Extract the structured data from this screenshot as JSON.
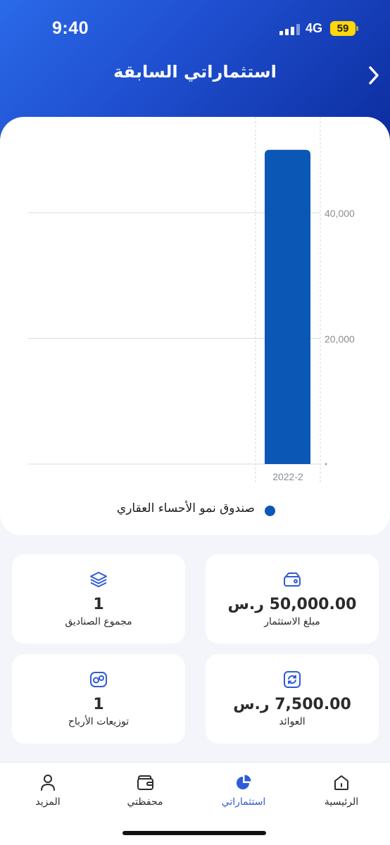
{
  "status_bar": {
    "time": "9:40",
    "network": "4G",
    "battery": "59"
  },
  "header": {
    "title": "استثماراتي السابقة",
    "back_icon": "chevron-right-icon"
  },
  "chart_data": {
    "type": "bar",
    "categories": [
      "2022-2"
    ],
    "series": [
      {
        "name": "صندوق نمو الأحساء العقاري",
        "values": [
          50000
        ]
      }
    ],
    "y_ticks": [
      "40,000",
      "20,000"
    ],
    "y_tick_values": [
      40000,
      20000
    ],
    "ylim": [
      0,
      50000
    ],
    "grid": true,
    "legend": "bottom",
    "bar_color": "#0b57b5"
  },
  "legend": {
    "label": "صندوق نمو الأحساء العقاري"
  },
  "stats": {
    "investment_amount": {
      "value": "50,000.00 ر.س",
      "label": "مبلغ الاستثمار",
      "icon": "wallet-icon"
    },
    "funds_total": {
      "value": "1",
      "label": "مجموع الصناديق",
      "icon": "layers-icon"
    },
    "returns": {
      "value": "7,500.00 ر.س",
      "label": "العوائد",
      "icon": "refresh-icon"
    },
    "profit_distributions": {
      "value": "1",
      "label": "توزيعات الأرباح",
      "icon": "coins-icon"
    }
  },
  "nav": {
    "items": [
      {
        "label": "الرئيسية",
        "icon": "home-icon"
      },
      {
        "label": "استثماراتي",
        "icon": "pie-chart-icon",
        "active": true
      },
      {
        "label": "محفظتي",
        "icon": "wallet-icon"
      },
      {
        "label": "المزيد",
        "icon": "user-icon"
      }
    ]
  },
  "colors": {
    "accent": "#2f5bd8",
    "header_start": "#2a6ae8",
    "header_end": "#0b2a9a",
    "bar": "#0b57b5"
  }
}
